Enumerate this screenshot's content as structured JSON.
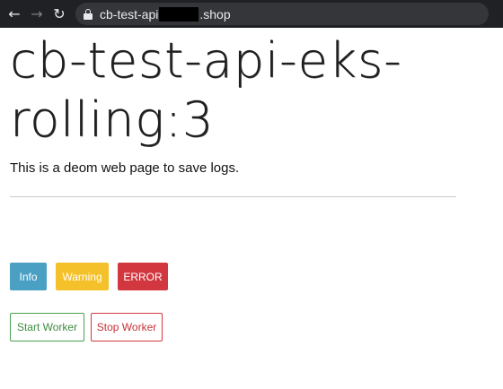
{
  "browser": {
    "url_prefix": "cb-test-api",
    "url_suffix": ".shop"
  },
  "page": {
    "title": "cb-test-api-eks-rolling:3",
    "subtitle": "This is a deom web page to save logs."
  },
  "log_buttons": {
    "info": "Info",
    "warning": "Warning",
    "error": "ERROR"
  },
  "worker_buttons": {
    "start": "Start Worker",
    "stop": "Stop Worker"
  },
  "colors": {
    "info": "#4aa0c3",
    "warning": "#f5c12a",
    "error": "#d2373f",
    "start": "#4aa04d",
    "stop": "#d2373f"
  }
}
